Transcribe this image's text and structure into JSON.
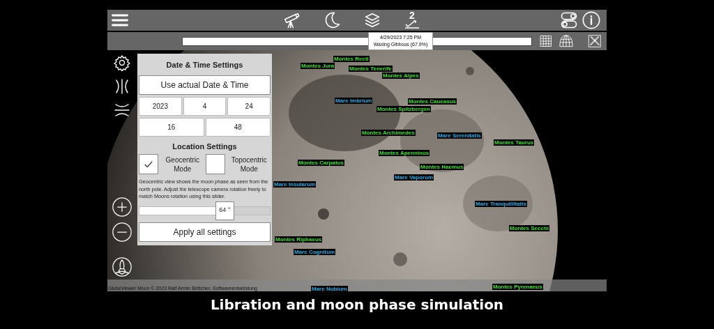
{
  "toolbar": {
    "phase_icon_number": "2"
  },
  "tooltip": {
    "date": "4/29/2023 7:25 PM",
    "phase": "Waxing Gibbous (67.9%)"
  },
  "settings_panel": {
    "date_title": "Date & Time Settings",
    "actual_button": "Use actual Date & Time",
    "date_fields": [
      "2023",
      "4",
      "24"
    ],
    "time_fields": [
      "16",
      "48"
    ],
    "location_title": "Location Settings",
    "modes": [
      {
        "label": "Geocentric Mode",
        "checked": true
      },
      {
        "label": "Topocentric Mode",
        "checked": false
      }
    ],
    "description": "Geocentric view shows the moon phase as seen from the north pole. Adjust the telescope camera rotation freely to match Moons rotation using this slider.",
    "rotation_slider": {
      "level": 0.65,
      "reading": "64 °"
    },
    "apply_button": "Apply all settings"
  },
  "moon_labels": [
    {
      "text": "Montes Jura",
      "kind": "mountain"
    },
    {
      "text": "Montes Recti",
      "kind": "mountain"
    },
    {
      "text": "Montes Tenerife",
      "kind": "mountain"
    },
    {
      "text": "Montes Alpes",
      "kind": "mountain"
    },
    {
      "text": "Mare Imbrium",
      "kind": "sea"
    },
    {
      "text": "Montes Spitzbergen",
      "kind": "mountain"
    },
    {
      "text": "Montes Caucasus",
      "kind": "mountain"
    },
    {
      "text": "Montes Archimedes",
      "kind": "mountain"
    },
    {
      "text": "Mare Serenitatis",
      "kind": "sea"
    },
    {
      "text": "Montes Taurus",
      "kind": "mountain"
    },
    {
      "text": "Montes Apenninus",
      "kind": "mountain"
    },
    {
      "text": "Montes Carpatus",
      "kind": "mountain"
    },
    {
      "text": "Montes Haemus",
      "kind": "mountain"
    },
    {
      "text": "Mare Insularum",
      "kind": "sea"
    },
    {
      "text": "Mare Vaporum",
      "kind": "sea"
    },
    {
      "text": "Mare Tranquillitatis",
      "kind": "sea"
    },
    {
      "text": "Montes Secchi",
      "kind": "mountain"
    },
    {
      "text": "Montes Riphaeus",
      "kind": "mountain"
    },
    {
      "text": "Mare Cognitum",
      "kind": "sea"
    },
    {
      "text": "Mare Nubium",
      "kind": "sea"
    },
    {
      "text": "Montes Pyrenaeus",
      "kind": "mountain"
    }
  ],
  "copyright": "GlobeViewer Moon © 2023 Ralf Armin Böttcher, Softwareentwicklung",
  "caption": "Libration and moon phase simulation"
}
